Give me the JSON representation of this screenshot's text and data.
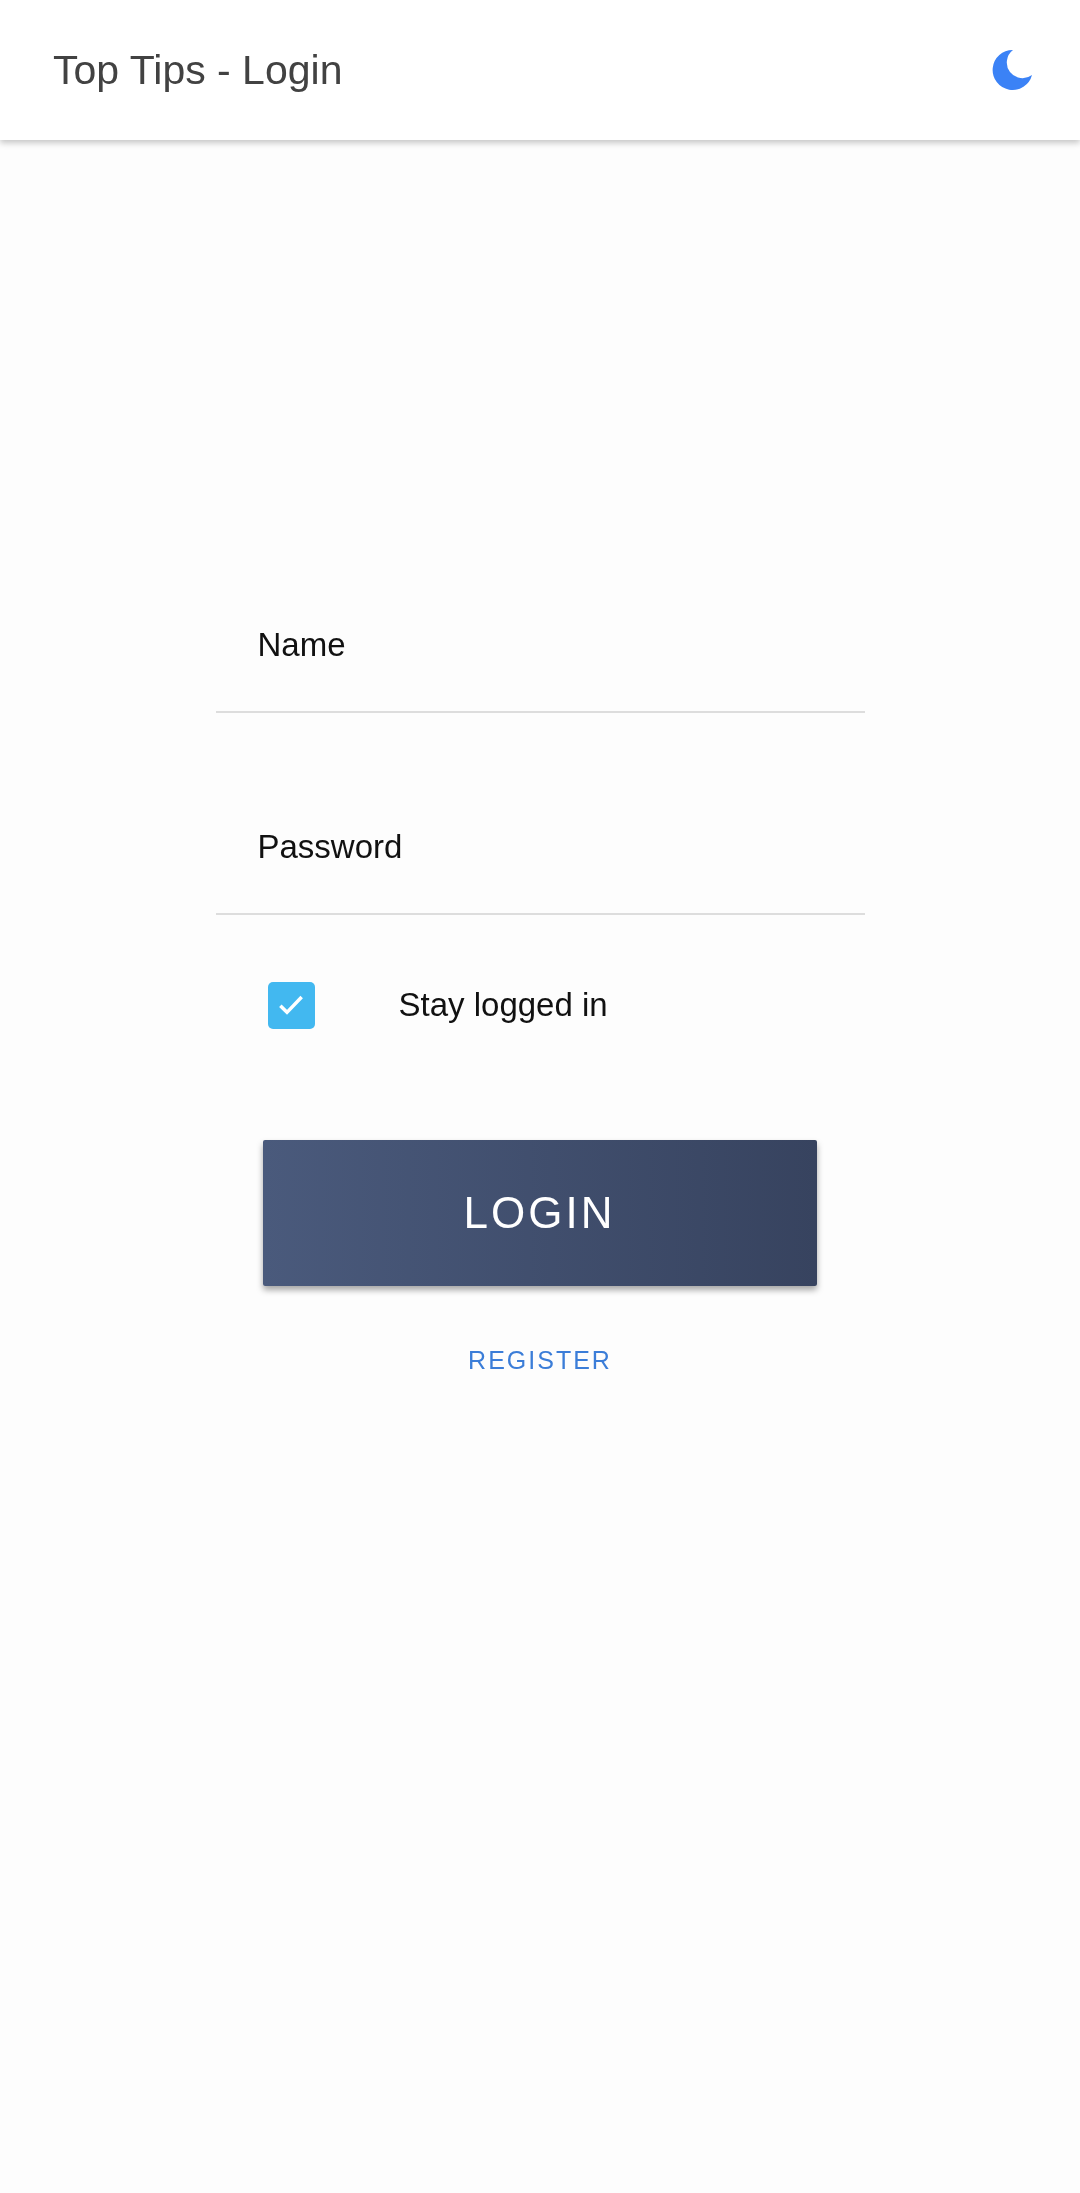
{
  "header": {
    "title": "Top Tips - Login"
  },
  "fields": [
    {
      "placeholder": "Name"
    },
    {
      "placeholder": "Password"
    }
  ],
  "stay_logged_in": {
    "label": "Stay logged in",
    "checked": true
  },
  "login_button": {
    "label": "LOGIN"
  },
  "register_link": {
    "label": "REGISTER"
  }
}
